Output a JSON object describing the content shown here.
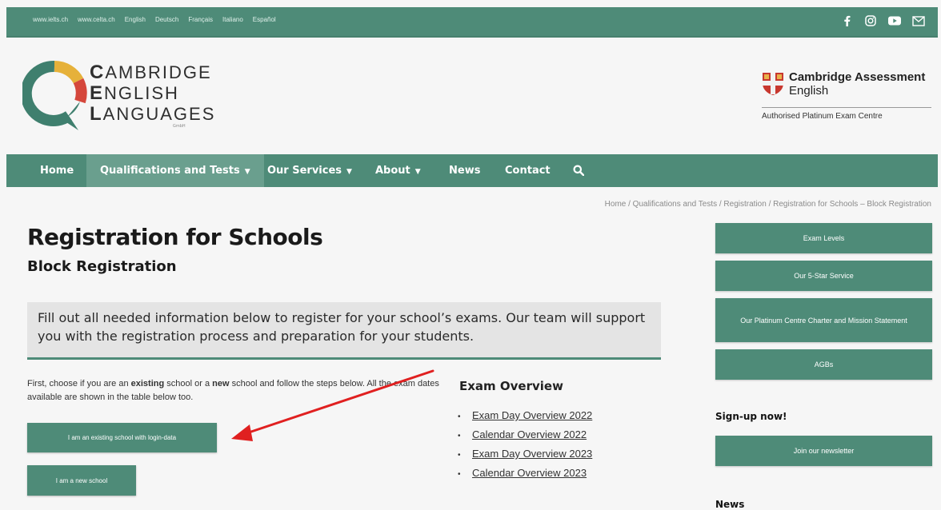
{
  "topbar": {
    "links": [
      "www.ielts.ch",
      "www.celta.ch",
      "English",
      "Deutsch",
      "Français",
      "Italiano",
      "Español"
    ],
    "social_icons": [
      "facebook-icon",
      "instagram-icon",
      "youtube-icon",
      "mail-icon"
    ]
  },
  "logo": {
    "line1_cap": "C",
    "line1_rest": "AMBRIDGE",
    "line2_cap": "E",
    "line2_rest": "NGLISH",
    "line3_cap": "L",
    "line3_rest": "ANGUAGES",
    "gmbh": "GmbH"
  },
  "partner": {
    "title": "Cambridge Assessment",
    "subtitle": "English",
    "authorised": "Authorised Platinum Exam Centre"
  },
  "nav": {
    "items": [
      {
        "label": "Home"
      },
      {
        "label": "Qualifications and Tests",
        "dropdown": true
      },
      {
        "label": "Our Services",
        "dropdown": true
      },
      {
        "label": "About",
        "dropdown": true
      },
      {
        "label": "News"
      },
      {
        "label": "Contact"
      }
    ],
    "search_icon": "search-icon"
  },
  "breadcrumb": "Home / Qualifications and Tests / Registration / Registration for Schools – Block Registration",
  "main": {
    "title": "Registration for Schools",
    "subtitle": "Block Registration",
    "info": "Fill out all needed information below to register for your school’s exams. Our team will support you with the registration process and preparation for your students.",
    "intro_part1": "First, choose if you are an ",
    "intro_bold1": "existing",
    "intro_part2": " school or a ",
    "intro_bold2": "new",
    "intro_part3": " school and follow the steps below. All the exam dates available are shown in the table below too.",
    "existing_button": "I am an existing school with login-data",
    "new_button": "I am a new school"
  },
  "exam_overview": {
    "heading": "Exam Overview",
    "links": [
      "Exam Day Overview 2022",
      "Calendar Overview 2022",
      "Exam Day Overview 2023",
      "Calendar Overview 2023"
    ]
  },
  "sidebar": {
    "buttons": [
      "Exam Levels",
      "Our 5-Star Service",
      "Our Platinum Centre Charter and Mission Statement",
      "AGBs"
    ],
    "signup_heading": "Sign-up now!",
    "newsletter_button": "Join our newsletter",
    "news_heading": "News"
  },
  "colors": {
    "brand_green": "#4e8b78",
    "active_nav": "#6a9f8e",
    "arrow_red": "#e02020"
  }
}
